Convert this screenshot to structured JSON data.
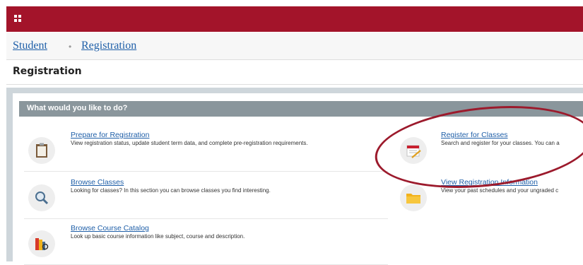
{
  "breadcrumb": {
    "items": [
      "Student",
      "Registration"
    ],
    "separator": "•"
  },
  "page": {
    "title": "Registration"
  },
  "panel": {
    "heading": "What would you like to do?"
  },
  "tiles": [
    {
      "title": "Prepare for Registration",
      "description": "View registration status, update student term data, and complete pre-registration requirements.",
      "icon": "clipboard-icon"
    },
    {
      "title": "Register for Classes",
      "description": "Search and register for your classes. You can a",
      "icon": "calendar-pencil-icon"
    },
    {
      "title": "Browse Classes",
      "description": "Looking for classes? In this section you can browse classes you find interesting.",
      "icon": "magnifier-icon"
    },
    {
      "title": "View Registration Information",
      "description": "View your past schedules and your ungraded c",
      "icon": "folder-icon"
    },
    {
      "title": "Browse Course Catalog",
      "description": "Look up basic course information like subject, course and description.",
      "icon": "books-icon"
    }
  ],
  "colors": {
    "brand": "#a3142a",
    "link": "#1f5fa8",
    "panel_header": "#8a969c",
    "highlight": "#9c1a2c"
  }
}
